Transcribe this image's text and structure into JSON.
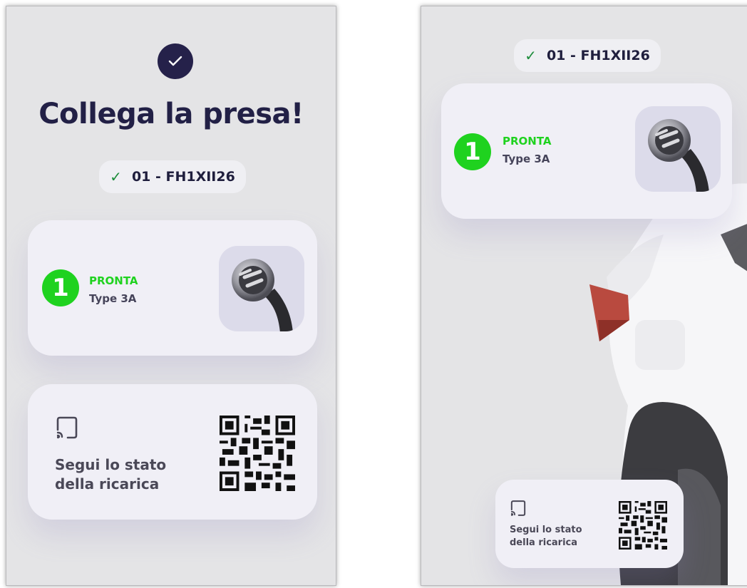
{
  "left": {
    "title": "Collega la presa!",
    "connector_code": "01 - FH1XII26",
    "outlet": {
      "number": "1",
      "status": "PRONTA",
      "type": "Type 3A"
    },
    "follow_text_line1": "Segui lo stato",
    "follow_text_line2": "della ricarica"
  },
  "right": {
    "connector_code": "01 - FH1XII26",
    "outlet": {
      "number": "1",
      "status": "PRONTA",
      "type": "Type 3A"
    },
    "follow_text_line1": "Segui lo stato",
    "follow_text_line2": "della ricarica"
  },
  "colors": {
    "accent_green": "#1fd21f",
    "dark_navy": "#222046",
    "check_green": "#1c8c3a"
  },
  "icons": [
    "check-circle-icon",
    "check-icon",
    "plug-icon",
    "cast-icon",
    "qr-code"
  ]
}
